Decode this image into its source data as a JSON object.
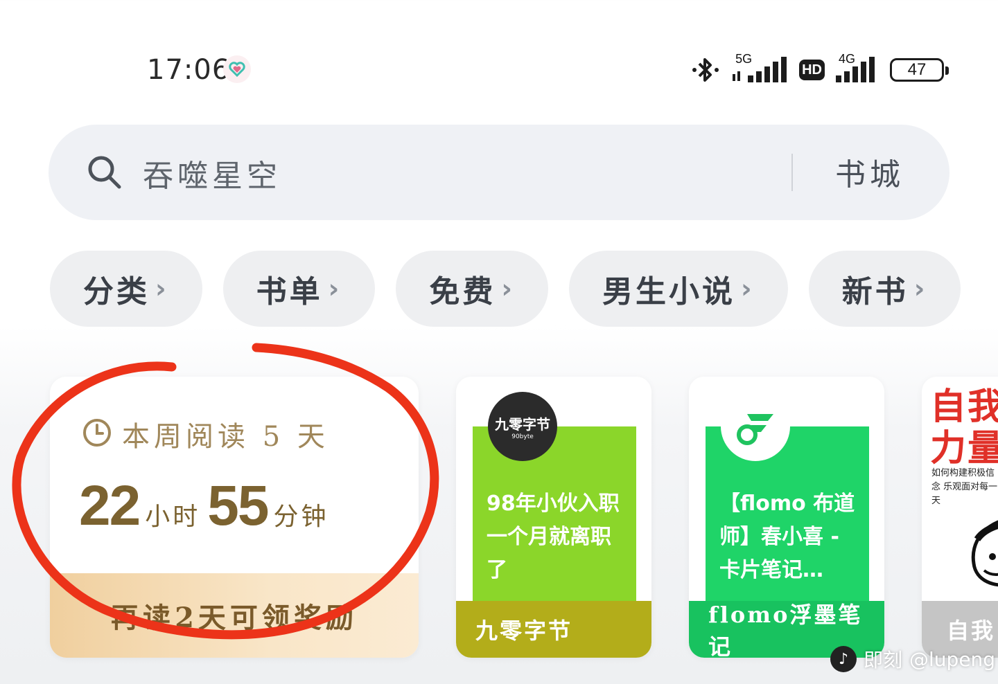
{
  "status_bar": {
    "time": "17:06",
    "net1": "5G",
    "hd": "HD",
    "net2": "4G",
    "battery": "47"
  },
  "search": {
    "query": "吞噬星空",
    "bookstore_label": "书城"
  },
  "chips": [
    {
      "label": "分类"
    },
    {
      "label": "书单"
    },
    {
      "label": "免费"
    },
    {
      "label": "男生小说"
    },
    {
      "label": "新书"
    }
  ],
  "chip_chevron": "›",
  "reading": {
    "title": "本周阅读 5 天",
    "hours": "22",
    "hours_unit": "小时",
    "minutes": "55",
    "minutes_unit": "分钟",
    "reward_text": "再读2天可领奖励"
  },
  "books": [
    {
      "logo_text": "九零字节",
      "logo_sub": "90byte",
      "cover_text": "98年小伙入职一个月就离职了",
      "author": "九零字节",
      "cover_color": "#8bd62a",
      "footer_color": "#b3ad1a"
    },
    {
      "cover_text": "【flomo 布道师】春小喜 - 卡片笔记…",
      "author": "flomo浮墨笔记",
      "cover_color": "#1fd468",
      "footer_color": "#18c25f"
    },
    {
      "cover_title": "自我力量",
      "cover_sub": "如何构建积极信念 乐观面对每一天",
      "author": "自我"
    }
  ],
  "watermark": {
    "brand": "即刻",
    "handle": "@lupeng"
  }
}
